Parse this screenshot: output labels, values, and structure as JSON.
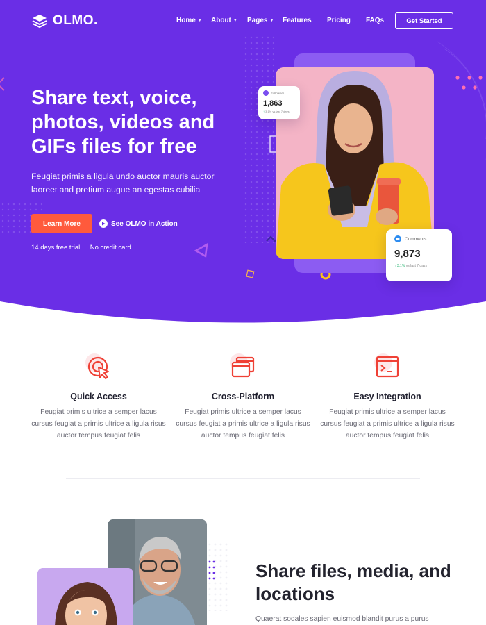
{
  "brand": {
    "name": "OLMO.",
    "accent": "#6a2ee6",
    "cta": "#ff5a3c"
  },
  "nav": {
    "items": [
      {
        "label": "Home",
        "has_dropdown": true
      },
      {
        "label": "About",
        "has_dropdown": true
      },
      {
        "label": "Pages",
        "has_dropdown": true
      },
      {
        "label": "Features",
        "has_dropdown": false
      },
      {
        "label": "Pricing",
        "has_dropdown": false
      },
      {
        "label": "FAQs",
        "has_dropdown": false
      }
    ],
    "cta_label": "Get Started"
  },
  "hero": {
    "headline": "Share text, voice, photos, videos and GIFs files for free",
    "subtext": "Feugiat primis a ligula undo auctor mauris auctor laoreet and pretium augue an egestas cubilia",
    "primary_button": "Learn More",
    "video_link": "See OLMO in Action",
    "trial_note": "14 days free trial",
    "card_note": "No credit card",
    "separator": "|",
    "followers_card": {
      "label": "Followers",
      "value": "1,863",
      "trend": "3.1% vs last 7 days"
    },
    "comments_card": {
      "label": "Comments",
      "value": "9,873",
      "trend_value": "3.1%",
      "trend_text": "vs last 7 days"
    }
  },
  "features": [
    {
      "icon": "cursor-click-icon",
      "title": "Quick Access",
      "text": "Feugiat primis ultrice a semper lacus cursus feugiat a primis ultrice a ligula risus auctor tempus feugiat felis"
    },
    {
      "icon": "windows-icon",
      "title": "Cross-Platform",
      "text": "Feugiat primis ultrice a semper lacus cursus feugiat a primis ultrice a ligula risus auctor tempus feugiat felis"
    },
    {
      "icon": "terminal-icon",
      "title": "Easy Integration",
      "text": "Feugiat primis ultrice a semper lacus cursus feugiat a primis ultrice a ligula risus auctor tempus feugiat felis"
    }
  ],
  "section2": {
    "title": "Share files, media, and locations",
    "text": "Quaerat sodales sapien euismod blandit purus a purus"
  }
}
